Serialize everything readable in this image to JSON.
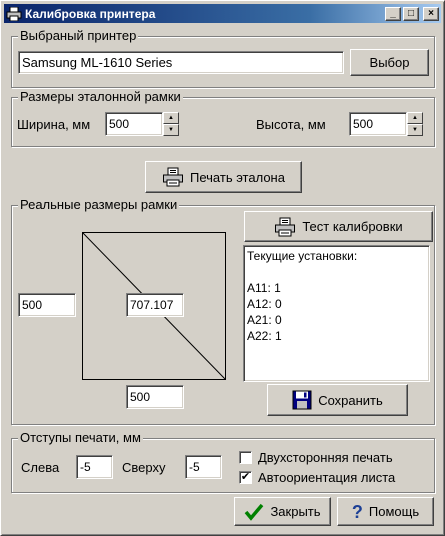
{
  "window": {
    "title": "Калибровка принтера",
    "controls": {
      "minimize": "_",
      "maximize": "□",
      "close": "×"
    }
  },
  "printer_group": {
    "label": "Выбраный принтер",
    "printer_name": "Samsung ML-1610 Series",
    "select_label": "Выбор"
  },
  "reference_group": {
    "label": "Размеры эталонной рамки",
    "width_label": "Ширина, мм",
    "width_value": "500",
    "height_label": "Высота, мм",
    "height_value": "500"
  },
  "print_reference_label": "Печать эталона",
  "real_group": {
    "label": "Реальные размеры рамки",
    "left_value": "500",
    "diagonal_value": "707.107",
    "bottom_value": "500",
    "test_label": "Тест калибровки",
    "settings_lines": [
      "Текущие установки:",
      "",
      "A11: 1",
      "A12: 0",
      "A21: 0",
      "A22: 1"
    ],
    "save_label": "Сохранить"
  },
  "margins_group": {
    "label": "Отступы печати, мм",
    "left_label": "Слева",
    "left_value": "-5",
    "top_label": "Сверху",
    "top_value": "-5",
    "duplex_label": "Двухсторонняя печать",
    "duplex_checked": false,
    "auto_orient_label": "Автоориентация листа",
    "auto_orient_checked": true
  },
  "footer": {
    "close_label": "Закрыть",
    "help_label": "Помощь"
  },
  "icons": {
    "app": "printer-app-icon",
    "print": "printer-icon",
    "save": "floppy-disk-icon",
    "close": "checkmark-icon",
    "help": "question-mark-icon"
  },
  "colors": {
    "face": "#d4d0c8",
    "title_start": "#0a246a",
    "title_end": "#a6caf0",
    "check_green": "#008000",
    "help_blue": "#1c3f95"
  }
}
